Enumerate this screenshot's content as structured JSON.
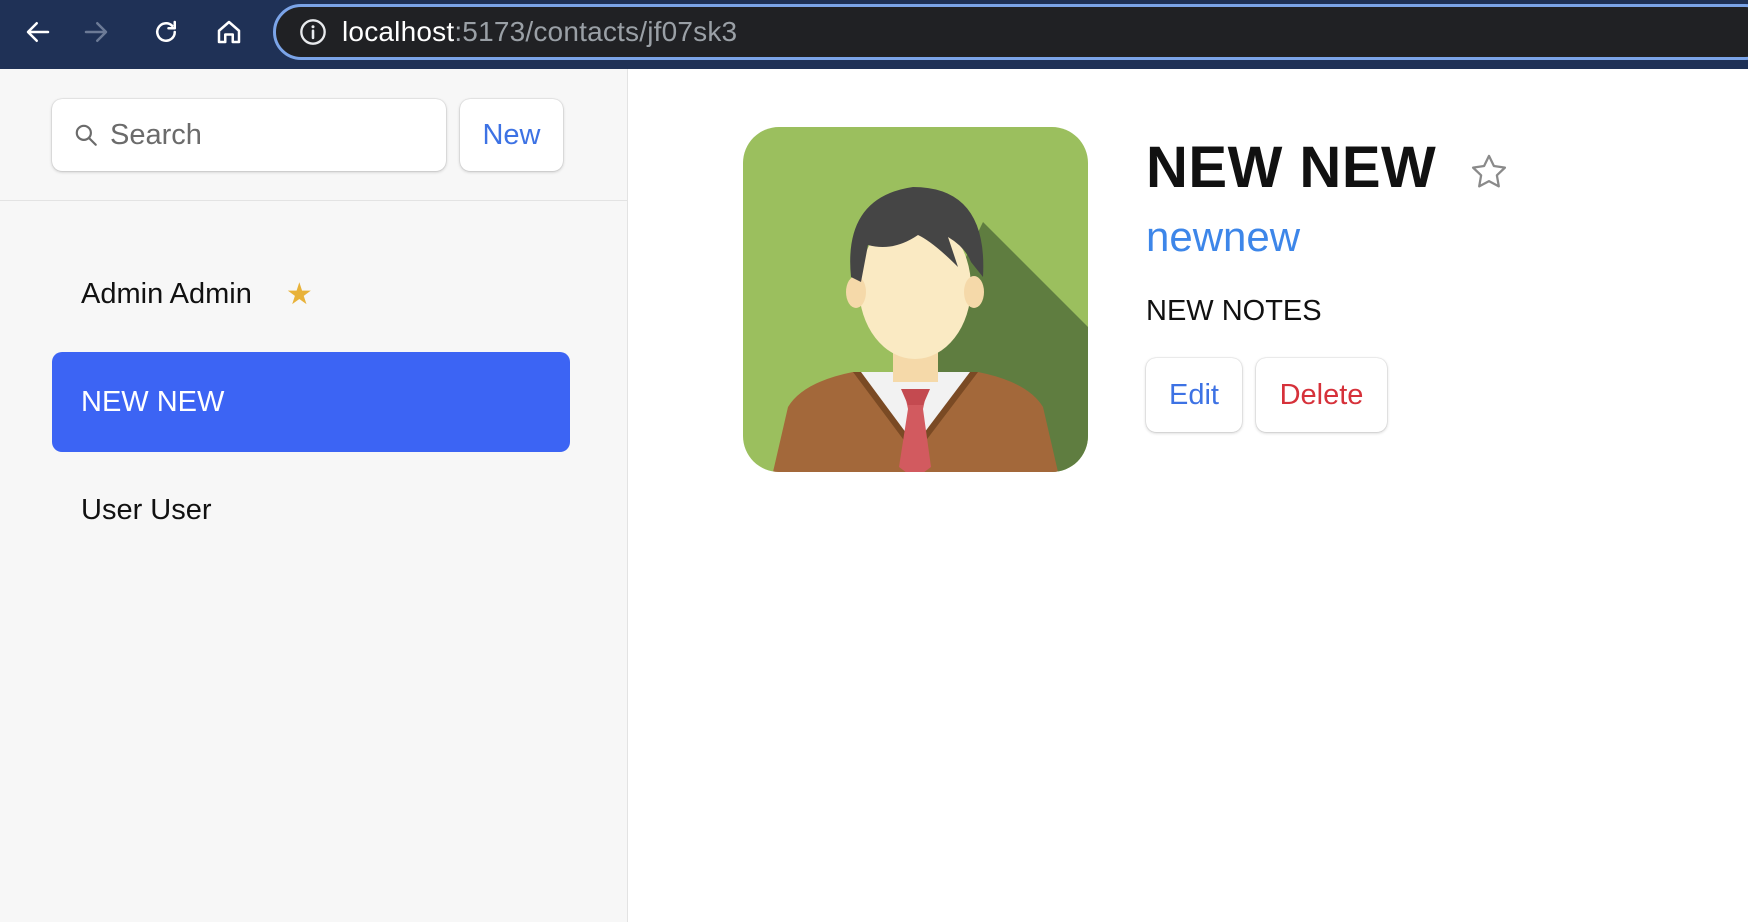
{
  "browser": {
    "url_host": "localhost",
    "url_path": ":5173/contacts/jf07sk3"
  },
  "sidebar": {
    "search": {
      "placeholder": "Search",
      "value": ""
    },
    "new_label": "New",
    "contacts": [
      {
        "name": "Admin Admin",
        "favorite": true,
        "active": false
      },
      {
        "name": "NEW NEW",
        "favorite": false,
        "active": true
      },
      {
        "name": "User User",
        "favorite": false,
        "active": false
      }
    ]
  },
  "contact": {
    "name": "NEW NEW",
    "handle": "newnew",
    "notes": "NEW NOTES",
    "favorite": false,
    "edit_label": "Edit",
    "delete_label": "Delete"
  },
  "colors": {
    "chrome": "#1f3156",
    "accent": "#3c64f4",
    "link": "#3d86e9",
    "danger": "#d6313a",
    "favorite_star": "#e8b23a"
  }
}
